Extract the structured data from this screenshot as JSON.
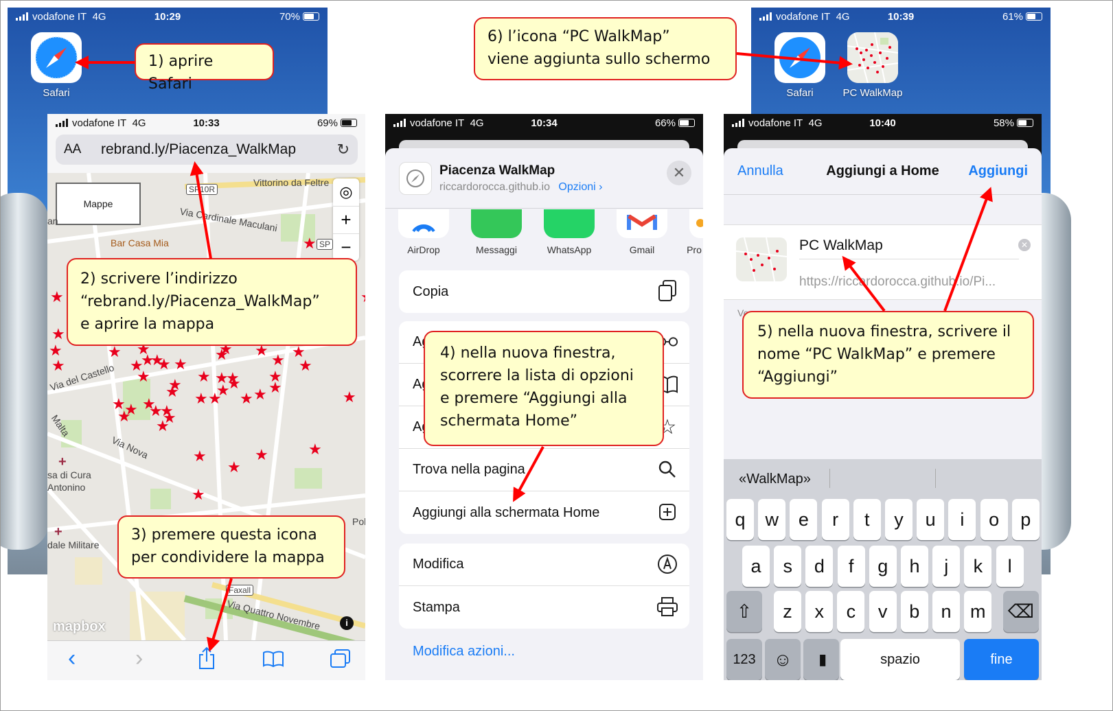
{
  "colors": {
    "callout_bg": "#ffffcc",
    "callout_border": "#e02020",
    "arrow": "#ff0000",
    "ios_blue": "#1a7cf5",
    "star_red": "#e8001c"
  },
  "home1": {
    "carrier": "vodafone IT",
    "network": "4G",
    "time": "10:29",
    "battery": "70%",
    "app_label": "Safari",
    "app_icon": "safari-compass-icon"
  },
  "home2": {
    "carrier": "vodafone IT",
    "network": "4G",
    "time": "10:39",
    "battery": "61%",
    "apps": [
      {
        "label": "Safari",
        "icon": "safari-compass-icon"
      },
      {
        "label": "PC WalkMap",
        "icon": "walkmap-thumbnail-icon"
      }
    ]
  },
  "safari": {
    "carrier": "vodafone IT",
    "network": "4G",
    "time": "10:33",
    "battery": "69%",
    "aa": "AA",
    "url": "rebrand.ly/Piacenza_WalkMap",
    "map": {
      "layer_button": "Mappe",
      "attribution": "mapbox",
      "streets": [
        "Vittorino da Feltre",
        "Via Cardinale Maculani",
        "SP10R",
        "SP",
        "Bar Casa Mia",
        "Via del Castello",
        "Malta",
        "Via Nova",
        "sa di Cura",
        "Antonino",
        "dale Militare",
        "Pol",
        "Faxall",
        "Via Quattro Novembre",
        "an"
      ]
    }
  },
  "share": {
    "carrier": "vodafone IT",
    "network": "4G",
    "time": "10:34",
    "battery": "66%",
    "title": "Piacenza WalkMap",
    "subtitle": "riccardorocca.github.io",
    "options": "Opzioni",
    "apps": [
      {
        "label": "AirDrop",
        "icon": "airdrop-icon"
      },
      {
        "label": "Messaggi",
        "icon": "messages-icon"
      },
      {
        "label": "WhatsApp",
        "icon": "whatsapp-icon"
      },
      {
        "label": "Gmail",
        "icon": "gmail-icon"
      },
      {
        "label": "Pro",
        "icon": "app-icon"
      }
    ],
    "actions": [
      {
        "label": "Copia",
        "icon": "copy-icon"
      },
      {
        "label": "Ag",
        "icon": "reading-glasses-icon"
      },
      {
        "label": "Ag",
        "icon": "book-icon"
      },
      {
        "label": "Ag",
        "icon": "star-icon"
      },
      {
        "label": "Trova nella pagina",
        "icon": "search-icon"
      },
      {
        "label": "Aggiungi alla schermata Home",
        "icon": "plus-square-icon"
      },
      {
        "label": "Modifica",
        "icon": "markup-icon"
      },
      {
        "label": "Stampa",
        "icon": "printer-icon"
      }
    ],
    "edit_actions": "Modifica azioni..."
  },
  "addhome": {
    "carrier": "vodafone IT",
    "network": "4G",
    "time": "10:40",
    "battery": "58%",
    "cancel": "Annulla",
    "title": "Aggiungi a Home",
    "add": "Aggiungi",
    "name": "PC WalkMap",
    "url": "https://riccardorocca.github.io/Pi...",
    "hint": "Ve",
    "suggestion": "«WalkMap»",
    "keyboard": {
      "row1": [
        "q",
        "w",
        "e",
        "r",
        "t",
        "y",
        "u",
        "i",
        "o",
        "p"
      ],
      "row2": [
        "a",
        "s",
        "d",
        "f",
        "g",
        "h",
        "j",
        "k",
        "l"
      ],
      "row3": [
        "z",
        "x",
        "c",
        "v",
        "b",
        "n",
        "m"
      ],
      "num": "123",
      "space": "spazio",
      "done": "fine"
    }
  },
  "callouts": {
    "c1": "1) aprire Safari",
    "c2a": "2) scrivere l’indirizzo",
    "c2b": "“rebrand.ly/Piacenza_WalkMap”",
    "c2c": "e aprire la mappa",
    "c3a": "3) premere questa icona",
    "c3b": "per condividere la mappa",
    "c4a": "4) nella nuova finestra,",
    "c4b": "scorrere la lista di opzioni",
    "c4c": "e premere “Aggiungi alla",
    "c4d": "schermata Home”",
    "c5a": "5) nella nuova finestra, scrivere il",
    "c5b": "nome “PC WalkMap” e premere",
    "c5c": "“Aggiungi”",
    "c6a": "6) l’icona “PC WalkMap”",
    "c6b": "viene aggiunta sullo schermo"
  }
}
